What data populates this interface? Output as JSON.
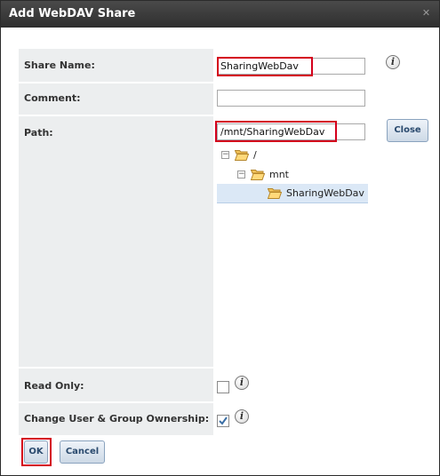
{
  "dialog": {
    "title": "Add WebDAV Share"
  },
  "form": {
    "share_name_label": "Share Name:",
    "share_name_value": "SharingWebDav",
    "comment_label": "Comment:",
    "comment_value": "",
    "path_label": "Path:",
    "path_value": "/mnt/SharingWebDav",
    "browse_close_label": "Close",
    "read_only_label": "Read Only:",
    "read_only_checked": false,
    "ownership_label": "Change User & Group Ownership:",
    "ownership_checked": true
  },
  "tree": {
    "root": "/",
    "child": "mnt",
    "grandchild": "SharingWebDav",
    "selected": "SharingWebDav"
  },
  "buttons": {
    "ok": "OK",
    "cancel": "Cancel"
  },
  "colors": {
    "highlight": "#d4001c",
    "selected_row": "#dbe8f6",
    "label_bg": "#eceeef"
  }
}
